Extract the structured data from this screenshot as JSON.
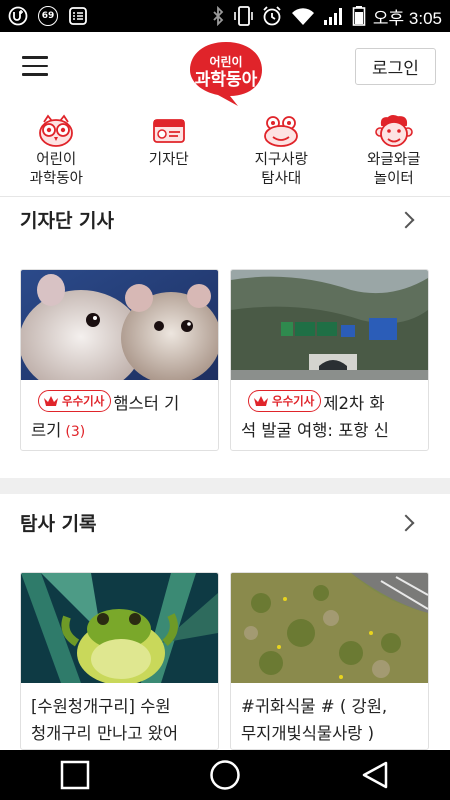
{
  "status_bar": {
    "notification_badge": "69",
    "time": "오후 3:05",
    "icons": [
      "u-plus-icon",
      "badge-69-icon",
      "list-icon",
      "bluetooth-icon",
      "phone-vibrate-icon",
      "alarm-icon",
      "wifi-icon",
      "signal-icon",
      "battery-icon"
    ]
  },
  "header": {
    "logo_line1": "어린이",
    "logo_line2": "과학동아",
    "login_label": "로그인",
    "brand_color": "#e0242a"
  },
  "categories": [
    {
      "label": "어린이\n과학동아",
      "icon": "owl-icon"
    },
    {
      "label": "기자단",
      "icon": "press-card-icon"
    },
    {
      "label": "지구사랑\n탐사대",
      "icon": "frog-icon"
    },
    {
      "label": "와글와글\n놀이터",
      "icon": "monkey-icon"
    }
  ],
  "sections": [
    {
      "title": "기자단 기사",
      "cards": [
        {
          "badge": "우수기사",
          "text_line1": "햄스터 기",
          "text_line2": "르기",
          "count": "(3)",
          "image": "hamsters-photo"
        },
        {
          "badge": "우수기사",
          "text_line1": "제2차 화",
          "text_line2": "석 발굴 여행: 포항 신",
          "image": "highway-tunnel-photo"
        }
      ]
    },
    {
      "title": "탐사 기록",
      "cards": [
        {
          "text_line1": "[수원청개구리] 수원",
          "text_line2": "청개구리 만나고 왔어",
          "image": "tree-frog-photo"
        },
        {
          "text_line1": "#귀화식물 # ( 강원,",
          "text_line2": "무지개빛식물사랑 )",
          "image": "roadside-grass-photo"
        }
      ]
    }
  ],
  "nav_bar": [
    "recent-apps-icon",
    "home-icon",
    "back-icon"
  ]
}
